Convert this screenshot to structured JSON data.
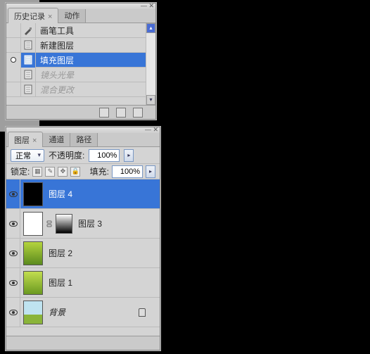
{
  "history": {
    "tabs": {
      "active": "历史记录",
      "other": "动作"
    },
    "items": [
      {
        "icon": "brush",
        "label": "画笔工具",
        "state": "normal"
      },
      {
        "icon": "doc",
        "label": "新建图层",
        "state": "normal"
      },
      {
        "icon": "doc",
        "label": "填充图层",
        "state": "selected"
      },
      {
        "icon": "doc",
        "label": "镜头光晕",
        "state": "dim"
      },
      {
        "icon": "doc",
        "label": "混合更改",
        "state": "dim"
      }
    ]
  },
  "layers": {
    "tabs": {
      "active": "图层",
      "others": [
        "通道",
        "路径"
      ]
    },
    "blend_label": "正常",
    "opacity_label": "不透明度:",
    "opacity_value": "100%",
    "lock_label": "锁定:",
    "fill_label": "填充:",
    "fill_value": "100%",
    "items": [
      {
        "name": "图层 4",
        "thumb": "black",
        "selected": true,
        "locked": false,
        "mask": null
      },
      {
        "name": "图层 3",
        "thumb": "white",
        "selected": false,
        "locked": false,
        "mask": "mask"
      },
      {
        "name": "图层 2",
        "thumb": "green",
        "selected": false,
        "locked": false,
        "mask": null
      },
      {
        "name": "图层 1",
        "thumb": "green2",
        "selected": false,
        "locked": false,
        "mask": null
      },
      {
        "name": "背景",
        "thumb": "sky",
        "selected": false,
        "locked": true,
        "mask": null,
        "italic": true
      }
    ]
  }
}
